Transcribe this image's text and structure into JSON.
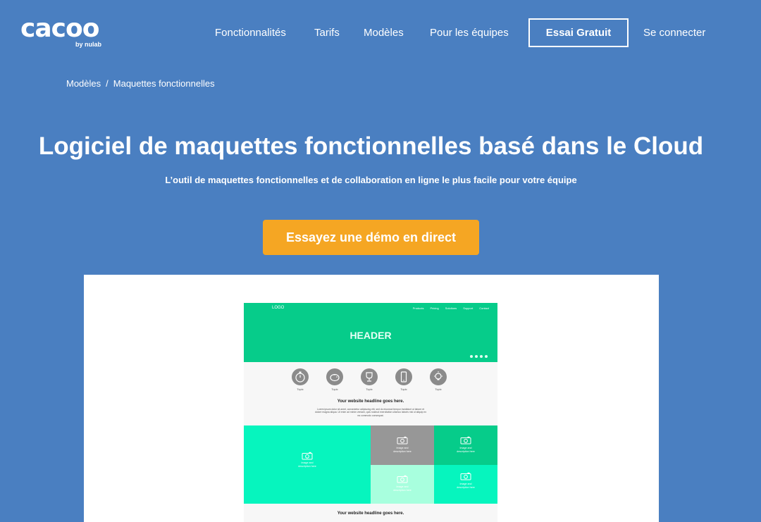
{
  "nav": {
    "logo_text": "cacoo",
    "logo_sub": "by nulab",
    "links": [
      "Fonctionnalités",
      "Tarifs",
      "Modèles",
      "Pour les équipes"
    ],
    "cta": "Essai Gratuit",
    "login": "Se connecter"
  },
  "breadcrumb": {
    "parent": "Modèles",
    "separator": "/",
    "current": "Maquettes fonctionnelles"
  },
  "hero": {
    "title": "Logiciel de maquettes fonctionnelles basé dans le Cloud",
    "subtitle": "L’outil de maquettes fonctionnelles et de collaboration en ligne le plus facile pour votre équipe",
    "demo_button": "Essayez une démo en direct"
  },
  "mockup": {
    "logo": "LOGO",
    "menu": [
      "Products",
      "Pricing",
      "Solutions",
      "Support",
      "Contact"
    ],
    "header": "HEADER",
    "topics": [
      {
        "label": "Topic",
        "icon": "stopwatch-icon"
      },
      {
        "label": "Topic",
        "icon": "piggy-bank-icon"
      },
      {
        "label": "Topic",
        "icon": "trophy-icon"
      },
      {
        "label": "Topic",
        "icon": "mobile-icon"
      },
      {
        "label": "Topic",
        "icon": "lightbulb-icon"
      }
    ],
    "headline": "Your website headline goes here.",
    "lorem": "Lorem ipsum dolor sit amet, consectetur adipiscing elit, sed do eiusmod tempor incididunt ut labore et dolore magna aliqua. Ut enim ad minim veniam, quis nostrud exercitation ullamco laboris nisi ut aliquip ex ea commodo consequat.",
    "tiles": [
      {
        "caption_1": "Image and",
        "caption_2": "description here"
      },
      {
        "caption_1": "Image and",
        "caption_2": "description here"
      },
      {
        "caption_1": "Image and",
        "caption_2": "description here"
      },
      {
        "caption_1": "Image and",
        "caption_2": "description here"
      },
      {
        "caption_1": "Image and",
        "caption_2": "description here"
      }
    ],
    "headline_2": "Your website headline goes here."
  },
  "colors": {
    "background": "#4a7fc1",
    "cta_orange": "#f5a623",
    "mock_green": "#06cc8a",
    "mock_mint": "#06f5be",
    "mock_gray": "#979797",
    "mock_light_mint": "#a8ffde"
  }
}
